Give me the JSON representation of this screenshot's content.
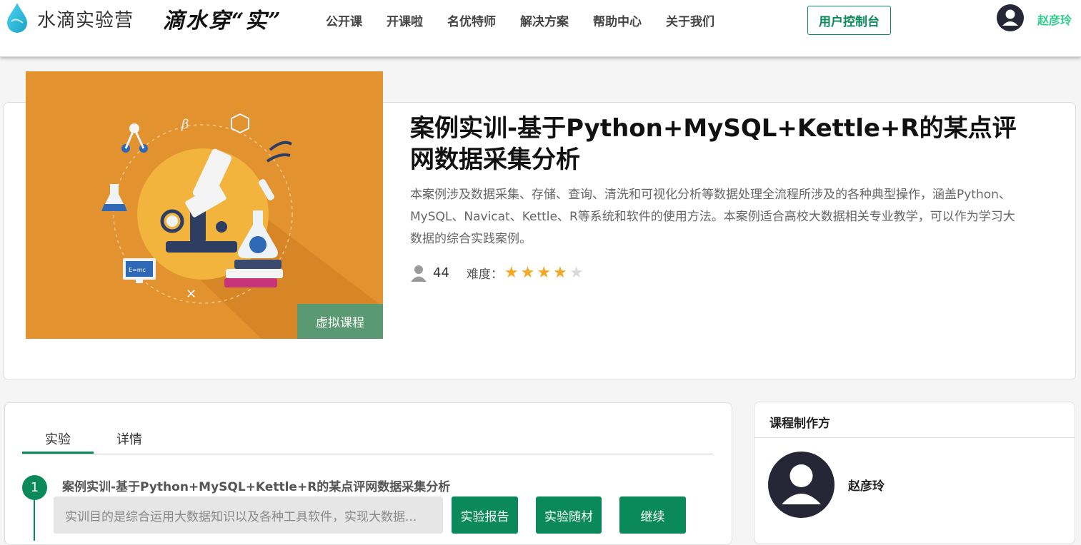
{
  "header": {
    "brand": "水滴实验营",
    "slogan": "滴水穿“实”",
    "nav": [
      "公开课",
      "开课啦",
      "名优特师",
      "解决方案",
      "帮助中心",
      "关于我们"
    ],
    "console_label": "用户控制台",
    "user_name": "赵彦玲"
  },
  "course": {
    "cover_label": "E=mc",
    "tag": "虚拟课程",
    "title": "案例实训-基于Python+MySQL+Kettle+R的某点评网数据采集分析",
    "description": "本案例涉及数据采集、存储、查询、清洗和可视化分析等数据处理全流程所涉及的各种典型操作，涵盖Python、MySQL、Navicat、Kettle、R等系统和软件的使用方法。本案例适合高校大数据相关专业教学，可以作为学习大数据的综合实践案例。",
    "learners": "44",
    "difficulty_label": "难度：",
    "difficulty_rating": 4,
    "difficulty_max": 5
  },
  "tabs": [
    {
      "label": "实验",
      "active": true
    },
    {
      "label": "详情",
      "active": false
    }
  ],
  "steps": [
    {
      "number": "1",
      "title": "案例实训-基于Python+MySQL+Kettle+R的某点评网数据采集分析",
      "description": "实训目的是综合运用大数据知识以及各种工具软件，实现大数据...",
      "buttons": [
        "实验报告",
        "实验随材",
        "继续"
      ]
    }
  ],
  "producer": {
    "heading": "课程制作方",
    "name": "赵彦玲"
  },
  "colors": {
    "primary": "#0a8a5a",
    "accent": "#2ecf8a",
    "cover_bg": "#e2922f",
    "tag_bg": "#5a9a72",
    "star_on": "#f5a623",
    "star_off": "#d9d9d9"
  }
}
